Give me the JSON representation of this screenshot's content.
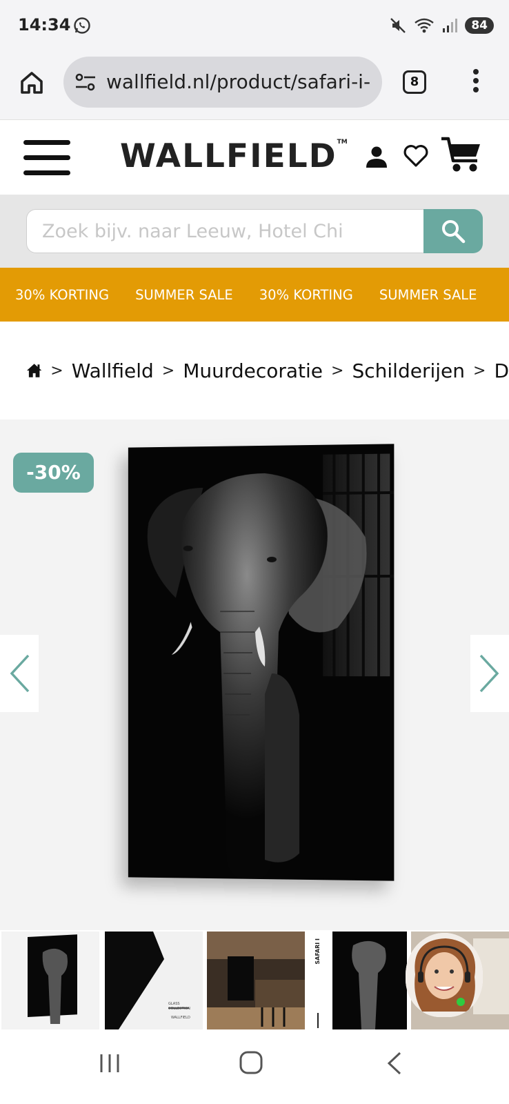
{
  "status_bar": {
    "time": "14:34",
    "battery": "84",
    "icons": [
      "whatsapp-icon",
      "mute-icon",
      "wifi-icon",
      "signal-icon",
      "battery-icon"
    ]
  },
  "browser": {
    "url": "wallfield.nl/product/safari-i-",
    "tab_count": "8"
  },
  "header": {
    "logo": "WALLFIELD",
    "logo_tm": "TM"
  },
  "search": {
    "placeholder": "Zoek bijv. naar Leeuw, Hotel Chi"
  },
  "promo": {
    "items": [
      "30% KORTING",
      "SUMMER SALE",
      "30% KORTING",
      "SUMMER SALE"
    ]
  },
  "breadcrumb": {
    "items": [
      "Wallfield",
      "Muurdecoratie",
      "Schilderijen",
      "D"
    ]
  },
  "product": {
    "discount": "-30%"
  },
  "thumbnails": {
    "safari_label": "SAFARI I",
    "glass_collection": "GLASS COLLECTION",
    "brand": "WALLFIELD"
  },
  "colors": {
    "accent": "#6aa9a0",
    "promo": "#e39b05"
  }
}
